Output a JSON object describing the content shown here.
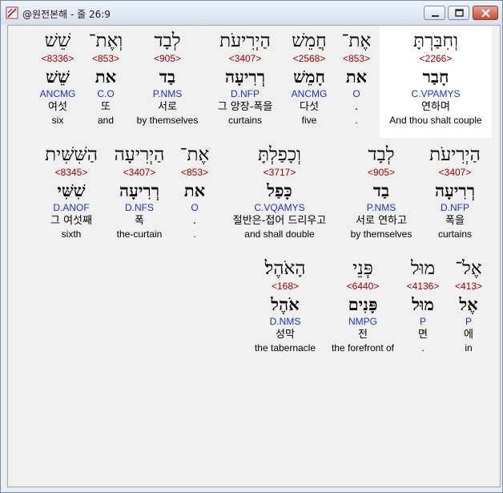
{
  "window": {
    "title": "@원전본해 - 줄 26:9"
  },
  "rows": [
    [
      {
        "heb": "וְחִבַּרְתָּ",
        "strong": "<2266>",
        "lemma": "חָבַר",
        "morph": "C.VPAMYS",
        "korean": "연하며",
        "english": "And thou shalt couple",
        "selected": true
      },
      {
        "heb": "אֶת־",
        "strong": "<853>",
        "lemma": "את",
        "morph": "O",
        "korean": ".",
        "english": "."
      },
      {
        "heb": "חֲמֵשׁ",
        "strong": "<2568>",
        "lemma": "חָמֵשׁ",
        "morph": "ANCMG",
        "korean": "다섯",
        "english": "five"
      },
      {
        "heb": "הַיְרִיעֹת",
        "strong": "<3407>",
        "lemma": "רְרִיעָה",
        "morph": "D.NFP",
        "korean": "그 앙장-폭을",
        "english": "curtains"
      },
      {
        "heb": "לְבָד",
        "strong": "<905>",
        "lemma": "בַד",
        "morph": "P.NMS",
        "korean": "서로",
        "english": "by themselves"
      },
      {
        "heb": "וְאֶת־",
        "strong": "<853>",
        "lemma": "את",
        "morph": "C.O",
        "korean": "또",
        "english": "and"
      },
      {
        "heb": "שֵׁשׁ",
        "strong": "<8336>",
        "lemma": "שֵׁשׁ",
        "morph": "ANCMG",
        "korean": "여섯",
        "english": "six"
      }
    ],
    [
      {
        "heb": "הַיְרִיעֹת",
        "strong": "<3407>",
        "lemma": "רְרִיעָה",
        "morph": "D.NFP",
        "korean": "폭을",
        "english": "curtains"
      },
      {
        "heb": "לְבָד",
        "strong": "<905>",
        "lemma": "בַד",
        "morph": "P.NMS",
        "korean": "서로 연하고",
        "english": "by themselves"
      },
      {
        "heb": "וְכָפַלְתָּ",
        "strong": "<3717>",
        "lemma": "כָּפַל",
        "morph": "C.VQAMYS",
        "korean": "절반은-접어 드리우고",
        "english": "and shall double"
      },
      {
        "heb": "אֶת־",
        "strong": "<853>",
        "lemma": "את",
        "morph": "O",
        "korean": ".",
        "english": "."
      },
      {
        "heb": "הַיְרִיעָה",
        "strong": "<3407>",
        "lemma": "רְרִיעָה",
        "morph": "D.NFS",
        "korean": "폭",
        "english": "the-curtain"
      },
      {
        "heb": "הַשִּׁשִּׁית",
        "strong": "<8345>",
        "lemma": "שִׁשִּׁי",
        "morph": "D.ANOF",
        "korean": "그 여섯째",
        "english": "sixth"
      }
    ],
    [
      {
        "heb": "אֶל־",
        "strong": "<413>",
        "lemma": "אֶל",
        "morph": "P",
        "korean": "에",
        "english": "in"
      },
      {
        "heb": "מוּל",
        "strong": "<4136>",
        "lemma": "מוּל",
        "morph": "P",
        "korean": "면",
        "english": "."
      },
      {
        "heb": "פְּנֵי",
        "strong": "<6440>",
        "lemma": "פָּנִים",
        "morph": "NMPG",
        "korean": "전",
        "english": "the forefront of"
      },
      {
        "heb": "הָאֹהֶל׃",
        "strong": "<168>",
        "lemma": "אֹהֶל",
        "morph": "D.NMS",
        "korean": "성막",
        "english": "the tabernacle"
      }
    ]
  ]
}
